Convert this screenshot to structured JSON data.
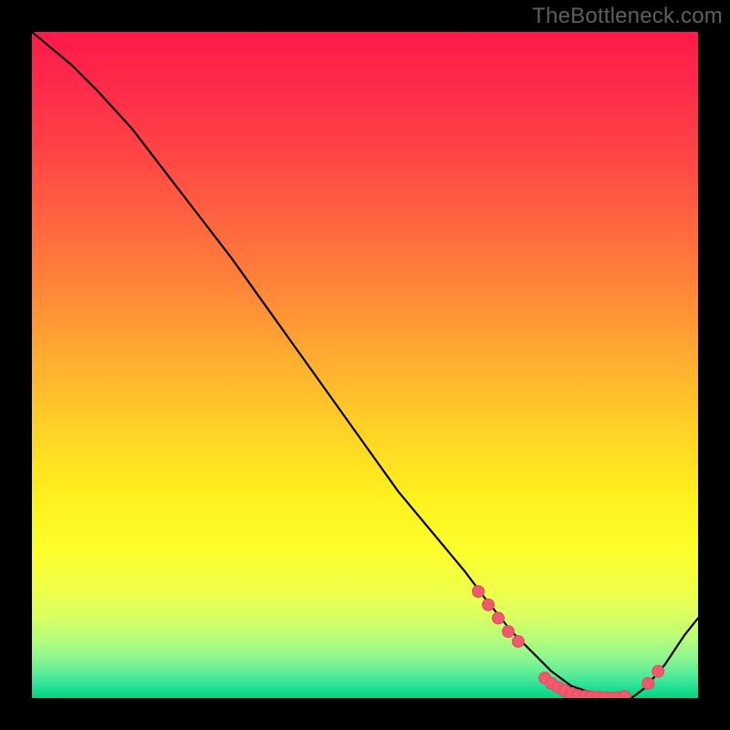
{
  "watermark": "TheBottleneck.com",
  "colors": {
    "black": "#000000",
    "curve": "#000000",
    "marker_fill": "#f05a6e",
    "marker_stroke": "#e7475b"
  },
  "gradient_stops": [
    {
      "offset": 0.0,
      "color": "#ff1a4b"
    },
    {
      "offset": 0.1,
      "color": "#ff2f49"
    },
    {
      "offset": 0.2,
      "color": "#ff4a44"
    },
    {
      "offset": 0.3,
      "color": "#ff6a3e"
    },
    {
      "offset": 0.4,
      "color": "#ff8b38"
    },
    {
      "offset": 0.5,
      "color": "#ffb030"
    },
    {
      "offset": 0.6,
      "color": "#ffd326"
    },
    {
      "offset": 0.7,
      "color": "#fff11e"
    },
    {
      "offset": 0.78,
      "color": "#fdff2c"
    },
    {
      "offset": 0.84,
      "color": "#eeff4a"
    },
    {
      "offset": 0.88,
      "color": "#d8ff64"
    },
    {
      "offset": 0.91,
      "color": "#b7fd7a"
    },
    {
      "offset": 0.94,
      "color": "#8df68f"
    },
    {
      "offset": 0.965,
      "color": "#56eb98"
    },
    {
      "offset": 0.985,
      "color": "#1fdf93"
    },
    {
      "offset": 1.0,
      "color": "#06d37f"
    }
  ],
  "chart_data": {
    "type": "line",
    "title": "",
    "xlabel": "",
    "ylabel": "",
    "xlim": [
      0,
      100
    ],
    "ylim": [
      0,
      100
    ],
    "series": [
      {
        "name": "bottleneck-curve",
        "x": [
          0,
          6,
          10,
          15,
          20,
          25,
          30,
          35,
          40,
          45,
          50,
          55,
          60,
          65,
          68,
          72,
          75,
          78,
          81,
          84,
          87,
          90,
          92,
          95,
          98,
          100
        ],
        "values": [
          100,
          95,
          91,
          85.5,
          79,
          72.5,
          66,
          59,
          52,
          45,
          38,
          31,
          25,
          19,
          15,
          10,
          7,
          4,
          1.8,
          0.8,
          0,
          0,
          1.5,
          5,
          9.5,
          12
        ]
      }
    ],
    "markers": {
      "name": "highlight-points",
      "x": [
        67,
        68.5,
        70,
        71.5,
        73,
        77,
        78,
        79,
        80,
        81,
        82,
        83,
        84,
        85,
        86,
        87,
        88,
        89,
        92.5,
        94
      ],
      "values": [
        16,
        14,
        12,
        10,
        8.5,
        3,
        2.2,
        1.6,
        1.1,
        0.7,
        0.4,
        0.25,
        0.15,
        0.1,
        0.05,
        0,
        0.05,
        0.2,
        2.2,
        4
      ]
    }
  }
}
